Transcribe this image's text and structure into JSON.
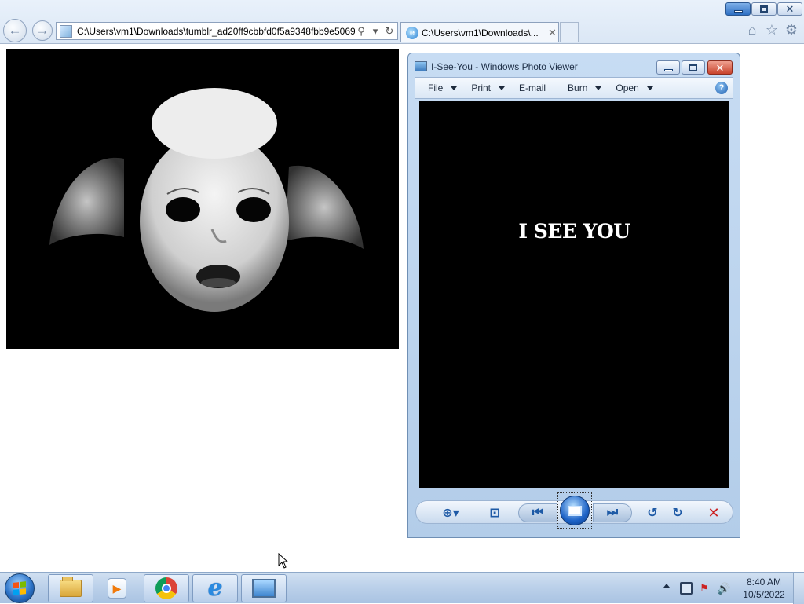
{
  "browser": {
    "address": "C:\\Users\\vm1\\Downloads\\tumblr_ad20ff9cbbfd0f5a9348fbb9e5069",
    "tab_label": "C:\\Users\\vm1\\Downloads\\...",
    "tab_close": "✕"
  },
  "photo_viewer": {
    "title": "I-See-You - Windows Photo Viewer",
    "menu": [
      "File",
      "Print",
      "E-mail",
      "Burn",
      "Open"
    ],
    "help": "?",
    "image_text": "I SEE YOU"
  },
  "taskbar": {
    "time": "8:40 AM",
    "date": "10/5/2022"
  },
  "icons": {
    "back": "back-arrow-icon",
    "forward": "forward-arrow-icon",
    "search": "search-icon",
    "refresh": "refresh-icon",
    "home": "home-icon",
    "favorites": "star-icon",
    "tools": "gear-icon"
  },
  "colors": {
    "accent": "#2d74c8",
    "close_red": "#c9432c"
  }
}
